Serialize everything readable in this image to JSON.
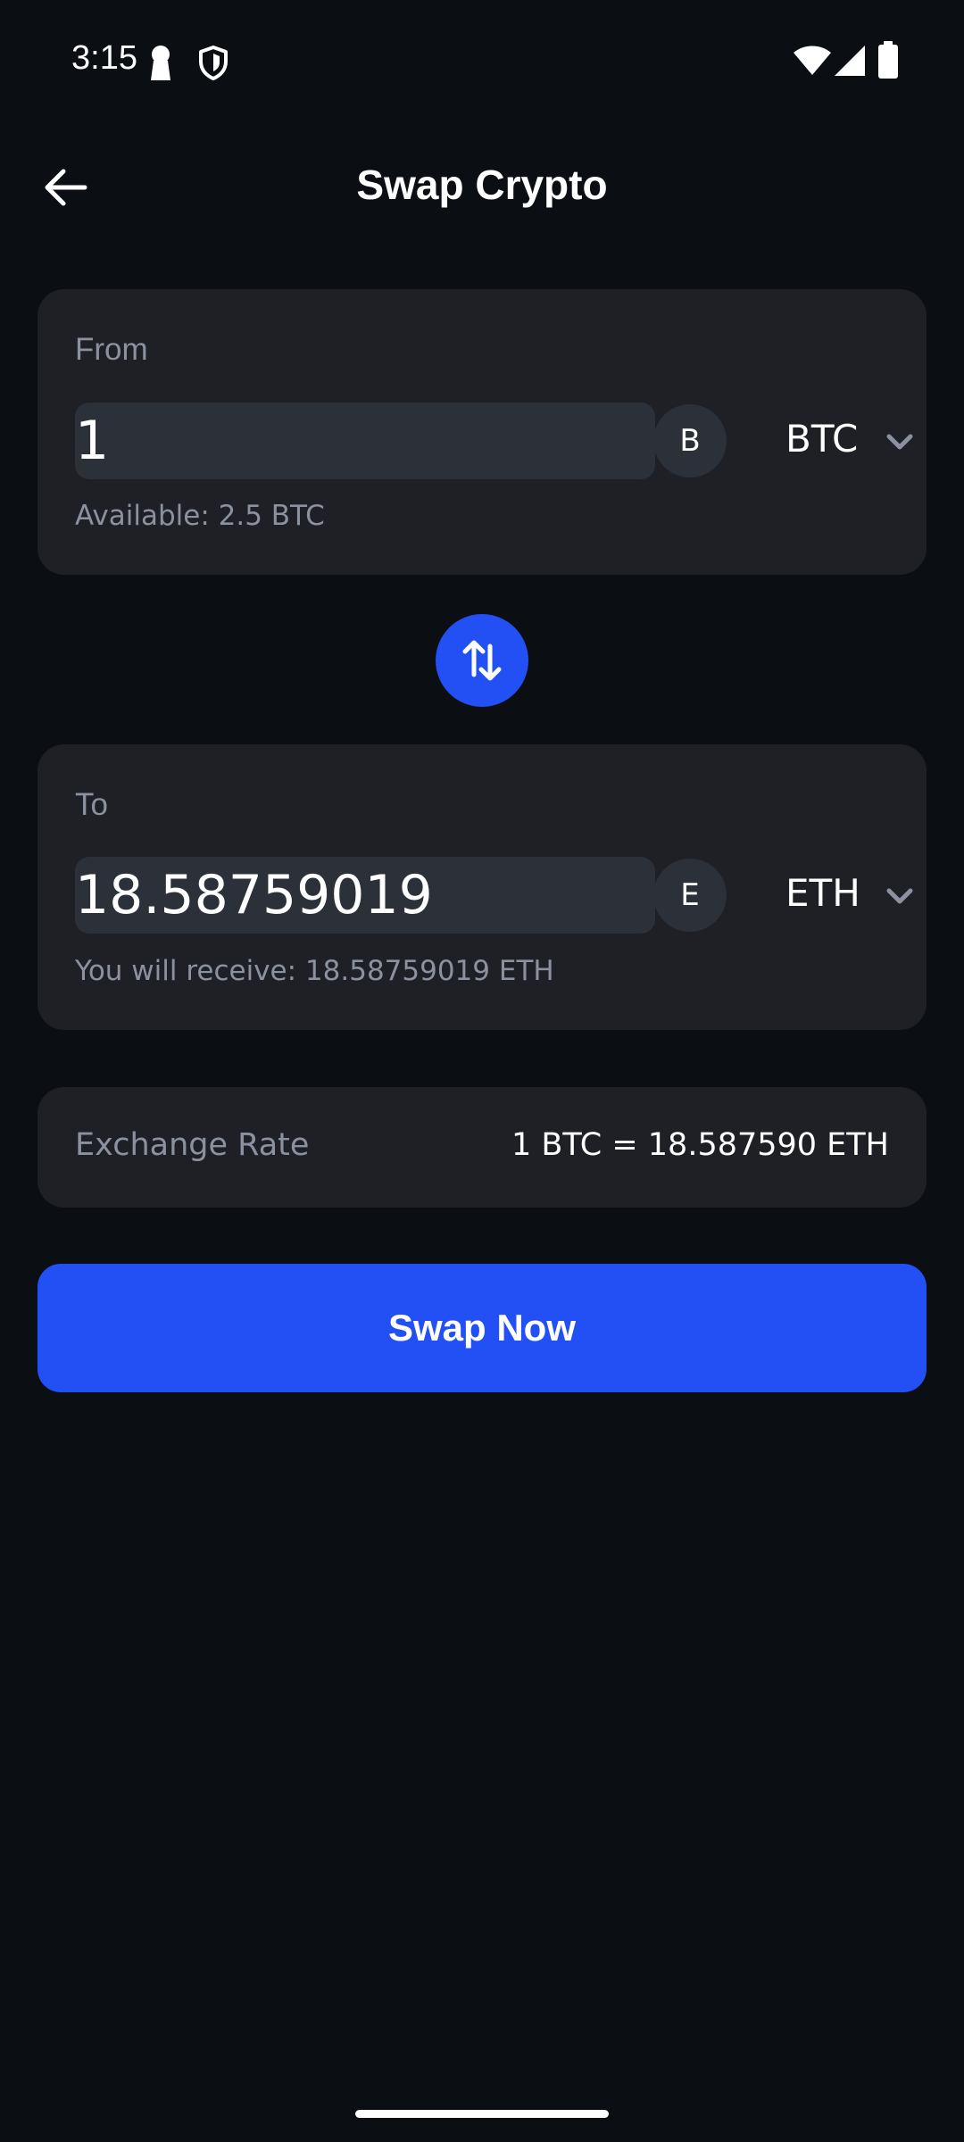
{
  "status_bar": {
    "time": "3:15",
    "icons": [
      "keyhole-icon",
      "shield-icon",
      "wifi-icon",
      "signal-icon",
      "battery-icon"
    ]
  },
  "header": {
    "title": "Swap Crypto",
    "back_icon": "arrow-left-icon"
  },
  "from_card": {
    "label": "From",
    "amount": "1",
    "coin_avatar": "B",
    "coin_code": "BTC",
    "hint": "Available: 2.5 BTC"
  },
  "swap_direction": {
    "icon": "swap-vertical-icon"
  },
  "to_card": {
    "label": "To",
    "amount": "18.58759019",
    "coin_avatar": "E",
    "coin_code": "ETH",
    "hint": "You will receive: 18.58759019 ETH"
  },
  "exchange_rate": {
    "label": "Exchange Rate",
    "value": "1 BTC = 18.587590 ETH"
  },
  "primary_action": {
    "label": "Swap Now"
  },
  "colors": {
    "background": "#0b0e13",
    "card": "#1e2026",
    "input": "#2b3039",
    "accent": "#2250f4",
    "muted_text": "#8b919e",
    "text": "#ffffff"
  }
}
